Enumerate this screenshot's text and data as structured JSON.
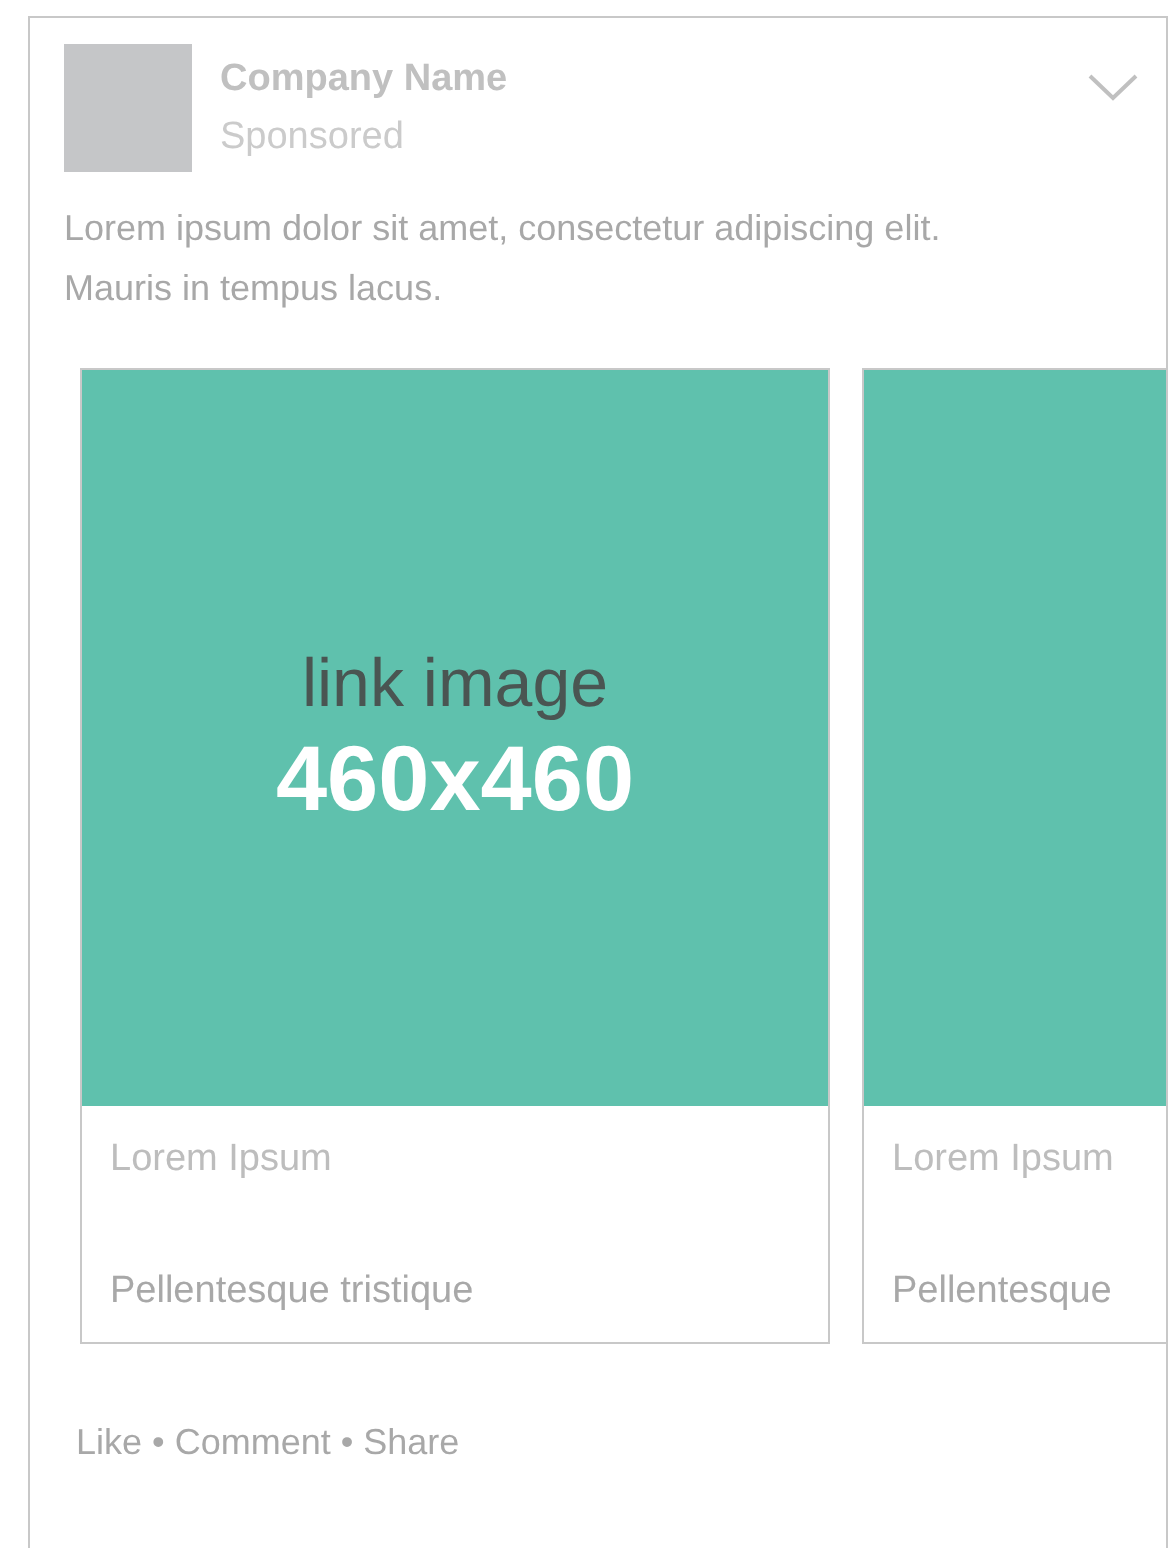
{
  "post": {
    "company_name": "Company Name",
    "label": "Sponsored",
    "text": "Lorem ipsum dolor sit amet, consectetur adipiscing elit. Mauris in tempus lacus."
  },
  "carousel": [
    {
      "image": {
        "caption": "link image",
        "size": "460x460"
      },
      "title": "Lorem Ipsum",
      "description": "Pellentesque tristique"
    },
    {
      "title": "Lorem Ipsum",
      "description": "Pellentesque"
    }
  ],
  "actions": "Like • Comment • Share"
}
